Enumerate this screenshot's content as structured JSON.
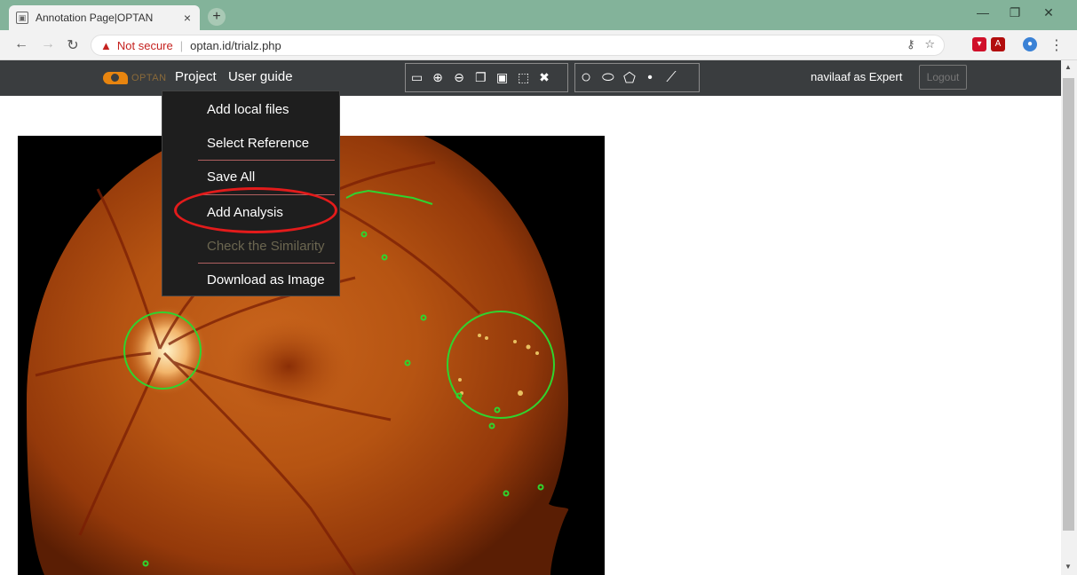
{
  "browser": {
    "tab_title": "Annotation Page|OPTAN",
    "tab_close": "×",
    "new_tab": "+",
    "security_label": "Not secure",
    "separator": "|",
    "url": "optan.id/trialz.php"
  },
  "app": {
    "logo_text": "OPTAN",
    "nav": {
      "project": "Project",
      "user_guide": "User guide"
    },
    "tool_icons_1": [
      "folder-icon",
      "zoom-in-icon",
      "zoom-out-icon",
      "copy-icon",
      "paste-icon",
      "select-box-icon",
      "delete-icon"
    ],
    "tool_icons_2": [
      "circle-icon",
      "ellipse-icon",
      "polygon-icon",
      "point-icon",
      "polyline-icon"
    ],
    "user_label": "navilaaf as Expert",
    "logout_label": "Logout"
  },
  "dropdown": {
    "add_local_files": "Add local files",
    "select_reference": "Select Reference",
    "save_all": "Save All",
    "add_analysis": "Add Analysis",
    "check_similarity": "Check the Similarity",
    "download_image": "Download as Image"
  },
  "colors": {
    "annotation": "#2fd42f",
    "highlight": "#e31b1b",
    "navbar": "#3a3d3f",
    "tabstrip": "#83b39a"
  }
}
